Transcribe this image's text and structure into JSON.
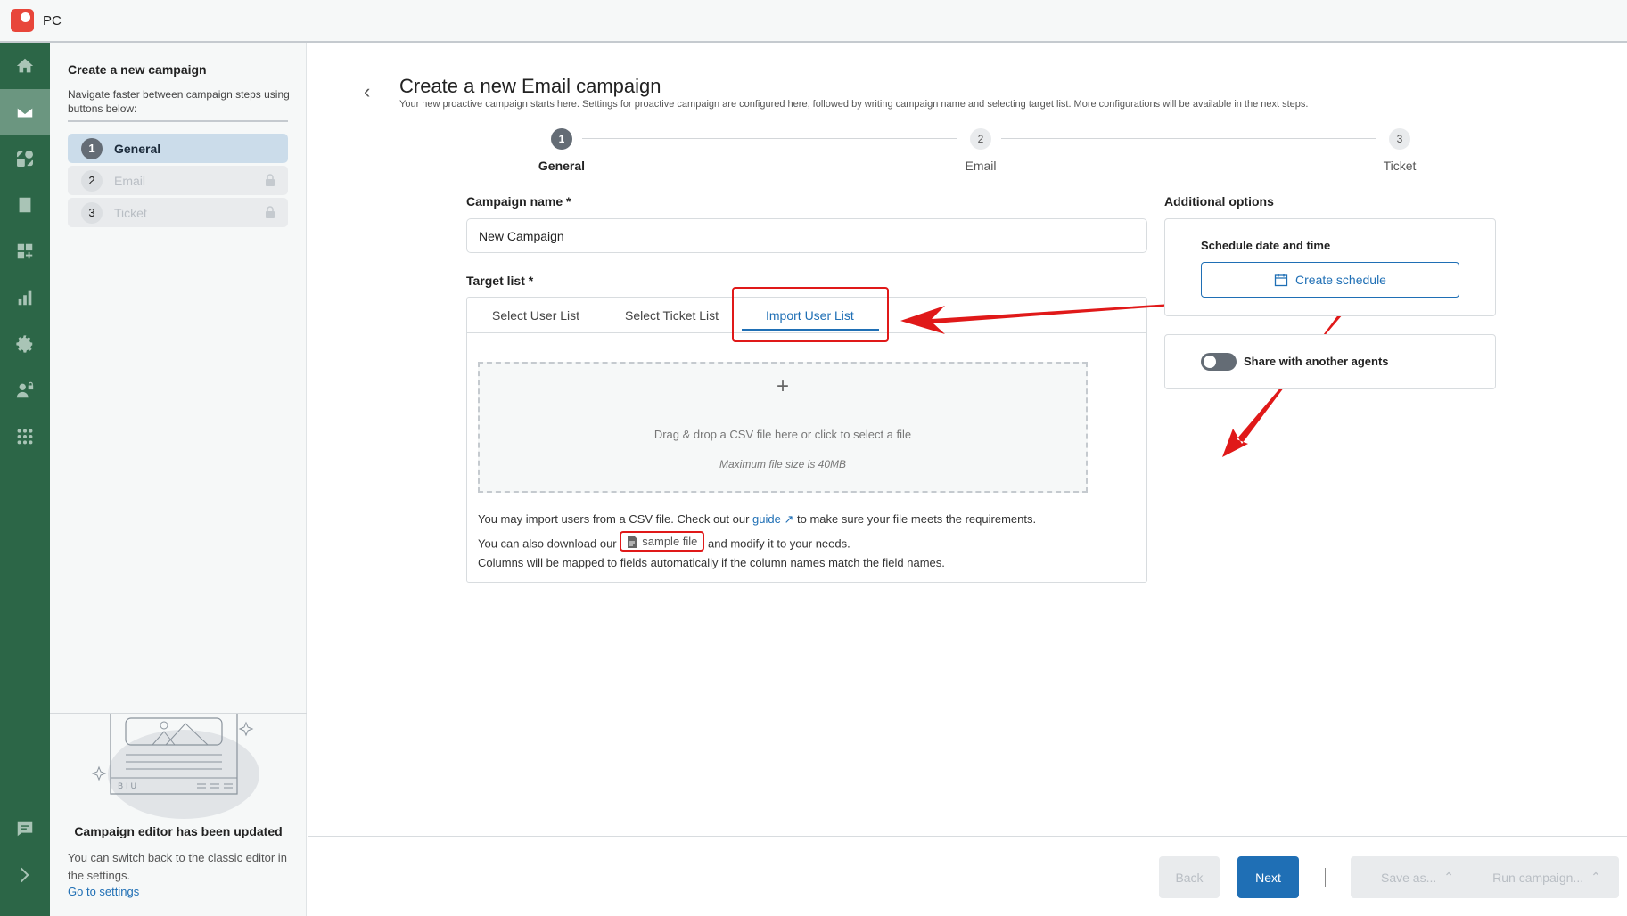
{
  "app": {
    "title": "PC",
    "logo_icon": "app-logo-icon"
  },
  "rail": {
    "items": [
      {
        "name": "home",
        "icon": "home-icon",
        "active": false
      },
      {
        "name": "email",
        "icon": "mail-icon",
        "active": true
      },
      {
        "name": "automation",
        "icon": "shapes-icon",
        "active": false
      },
      {
        "name": "inbox",
        "icon": "inbox-icon",
        "active": false
      },
      {
        "name": "add-widget",
        "icon": "grid-plus-icon",
        "active": false
      },
      {
        "name": "reports",
        "icon": "bar-chart-icon",
        "active": false
      },
      {
        "name": "settings",
        "icon": "gear-icon",
        "active": false
      },
      {
        "name": "user-permissions",
        "icon": "user-lock-icon",
        "active": false
      },
      {
        "name": "apps",
        "icon": "apps-grid-icon",
        "active": false
      }
    ],
    "bottom": [
      {
        "name": "feedback",
        "icon": "chat-icon"
      },
      {
        "name": "expand",
        "icon": "chevron-right-icon"
      }
    ]
  },
  "steps_panel": {
    "title": "Create a new campaign",
    "subtitle": "Navigate faster between campaign steps using buttons below:",
    "steps": [
      {
        "num": "1",
        "label": "General",
        "active": true,
        "locked": false
      },
      {
        "num": "2",
        "label": "Email",
        "active": false,
        "locked": true
      },
      {
        "num": "3",
        "label": "Ticket",
        "active": false,
        "locked": true
      }
    ],
    "update_notice": {
      "title": "Campaign editor has been updated",
      "text": "You can switch back to the classic editor in the settings.",
      "link": "Go to settings"
    }
  },
  "main": {
    "title": "Create a new Email campaign",
    "subtitle": "Your new proactive campaign starts here. Settings for proactive campaign are configured here, followed by writing campaign name and selecting target list. More configurations will be available in the next steps.",
    "stepper": [
      {
        "num": "1",
        "label": "General",
        "active": true
      },
      {
        "num": "2",
        "label": "Email",
        "active": false
      },
      {
        "num": "3",
        "label": "Ticket",
        "active": false
      }
    ],
    "campaign_name": {
      "label": "Campaign name *",
      "value": "New Campaign"
    },
    "target_list": {
      "label": "Target list *",
      "tabs": [
        {
          "label": "Select User List",
          "active": false
        },
        {
          "label": "Select Ticket List",
          "active": false
        },
        {
          "label": "Import User List",
          "active": true
        }
      ],
      "dropzone": {
        "plus": "+",
        "text": "Drag & drop a CSV file here or click to select a file",
        "max_size": "Maximum file size is 40MB"
      },
      "info": {
        "line1_pre": "You may import users from a CSV file. Check out our",
        "guide_link": "guide",
        "line1_post": "to make sure your file meets the requirements.",
        "line2_pre": "You can also download our",
        "sample_link": "sample file",
        "line2_post": "and modify it to your needs.",
        "line3": "Columns will be mapped to fields automatically if the column names match the field names."
      }
    },
    "additional_options": {
      "label": "Additional options",
      "schedule": {
        "title": "Schedule date and time",
        "button": "Create schedule"
      },
      "share": {
        "label": "Share with another agents",
        "enabled": false
      }
    }
  },
  "footer": {
    "back": "Back",
    "next": "Next",
    "save_as": "Save as...",
    "run": "Run campaign..."
  },
  "annotations": {
    "color": "#e01919"
  },
  "colors": {
    "rail": "#2c6647",
    "accent": "#1f6fb5",
    "annotation": "#e01919"
  }
}
